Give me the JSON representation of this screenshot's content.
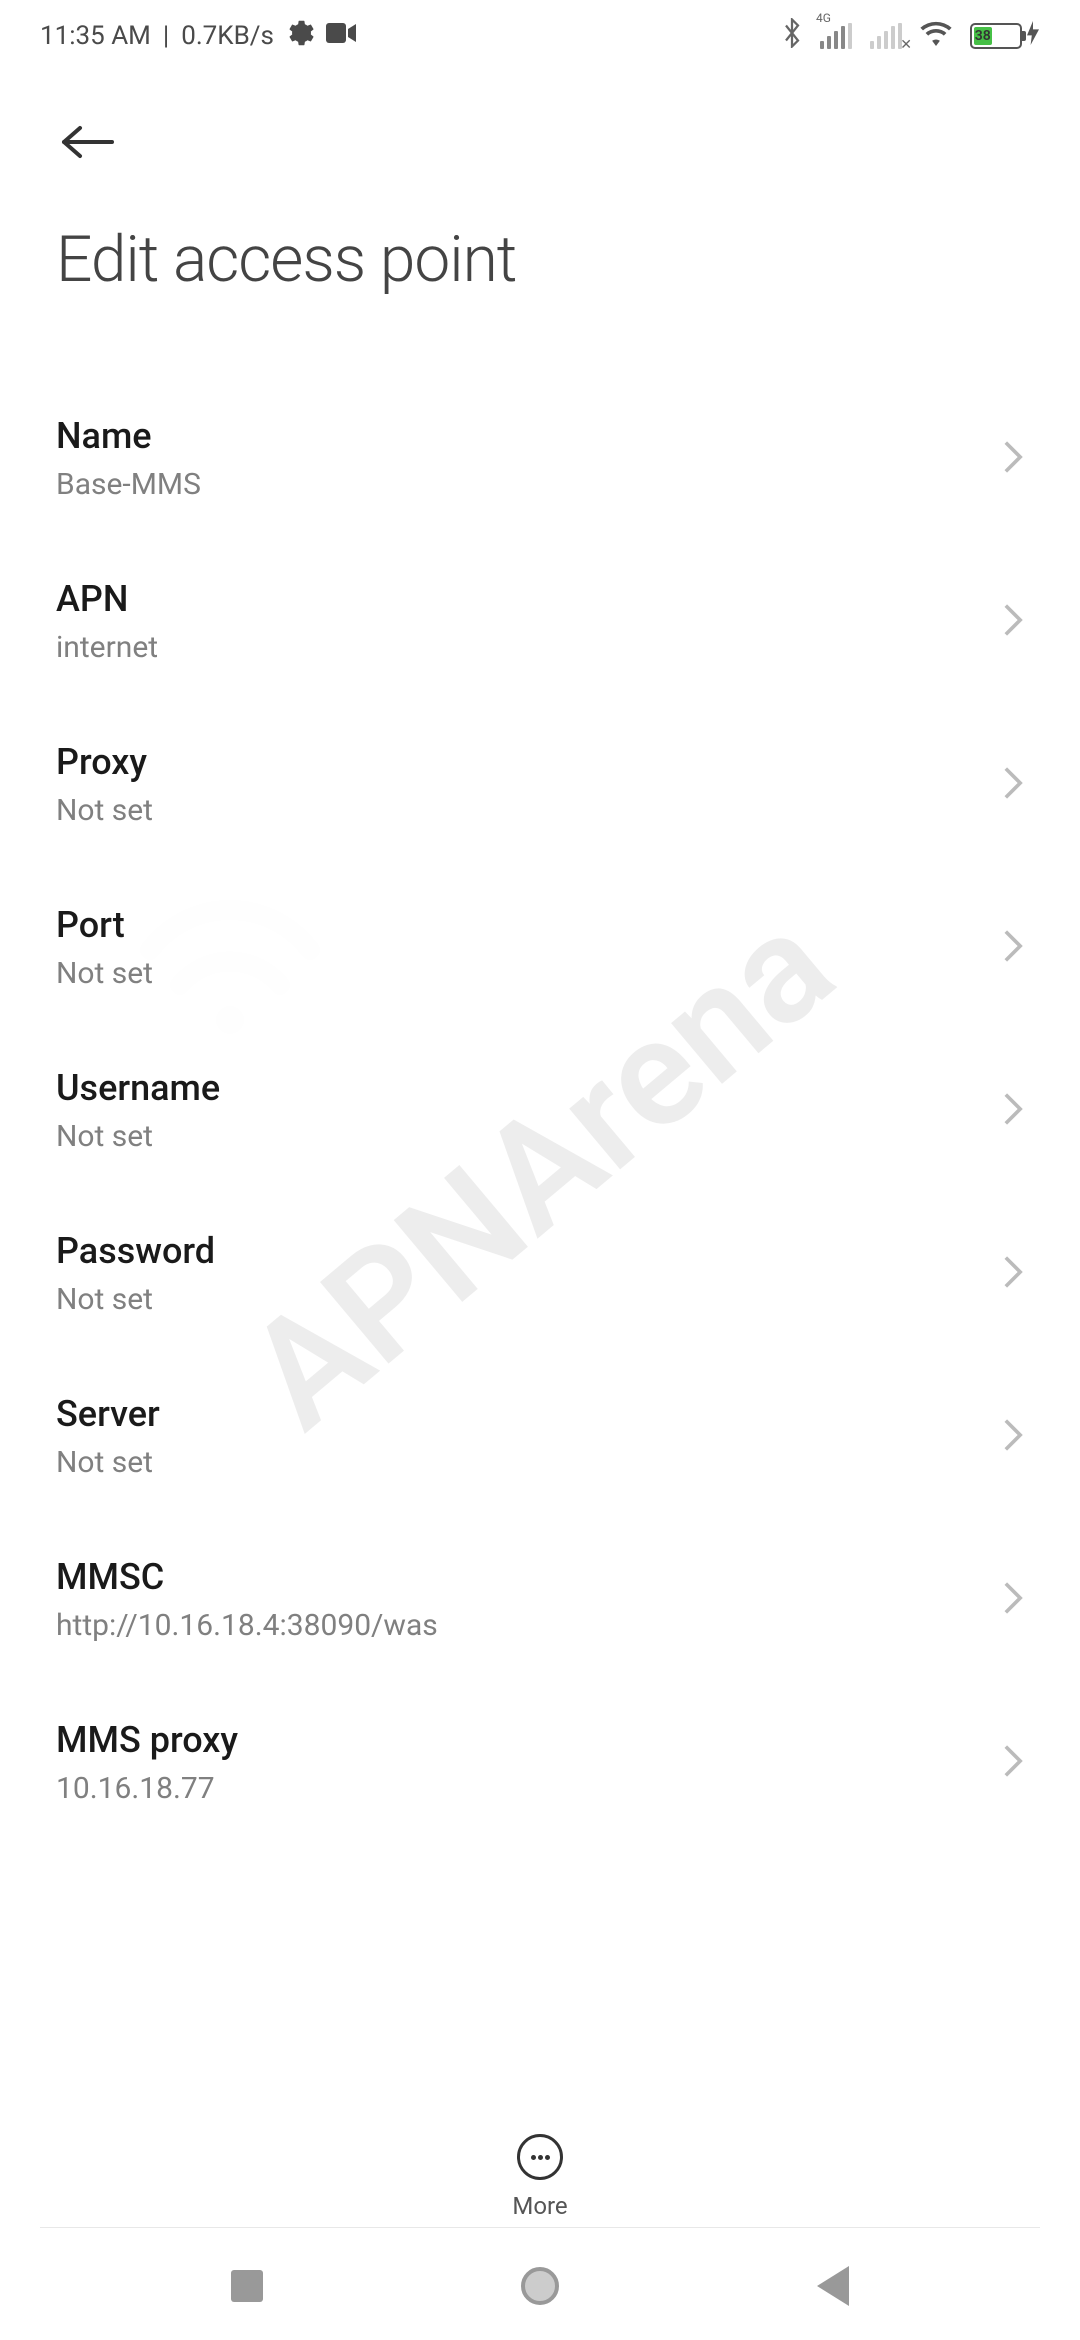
{
  "status_bar": {
    "time": "11:35 AM",
    "data_speed": "0.7KB/s",
    "battery_level": "38"
  },
  "header": {
    "title": "Edit access point"
  },
  "settings": [
    {
      "label": "Name",
      "value": "Base-MMS"
    },
    {
      "label": "APN",
      "value": "internet"
    },
    {
      "label": "Proxy",
      "value": "Not set"
    },
    {
      "label": "Port",
      "value": "Not set"
    },
    {
      "label": "Username",
      "value": "Not set"
    },
    {
      "label": "Password",
      "value": "Not set"
    },
    {
      "label": "Server",
      "value": "Not set"
    },
    {
      "label": "MMSC",
      "value": "http://10.16.18.4:38090/was"
    },
    {
      "label": "MMS proxy",
      "value": "10.16.18.77"
    }
  ],
  "toolbar": {
    "more_label": "More"
  },
  "watermark": {
    "text": "APNArena"
  }
}
